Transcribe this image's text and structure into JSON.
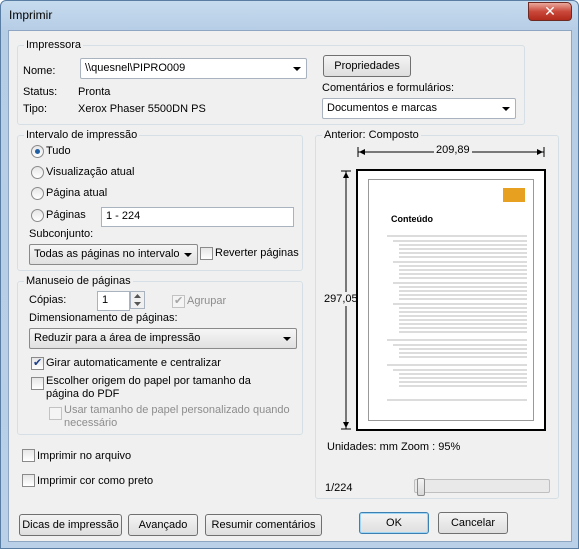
{
  "window": {
    "title": "Imprimir",
    "close_glyph": "✕"
  },
  "printer": {
    "group_label": "Impressora",
    "name_label": "Nome:",
    "name_value": "\\\\quesnel\\PIPRO009",
    "status_label": "Status:",
    "status_value": "Pronta",
    "type_label": "Tipo:",
    "type_value": "Xerox Phaser 5500DN PS",
    "properties_button": "Propriedades",
    "comments_label": "Comentários e formulários:",
    "comments_value": "Documentos e marcas"
  },
  "range": {
    "group_label": "Intervalo de impressão",
    "options": [
      "Tudo",
      "Visualização atual",
      "Página atual",
      "Páginas"
    ],
    "selected": "Tudo",
    "pages_value": "1 - 224",
    "subset_label": "Subconjunto:",
    "subset_value": "Todas as páginas no intervalo",
    "reverse_label": "Reverter páginas"
  },
  "handling": {
    "group_label": "Manuseio de páginas",
    "copies_label": "Cópias:",
    "copies_value": "1",
    "collate_label": "Agrupar",
    "sizing_label": "Dimensionamento de páginas:",
    "sizing_value": "Reduzir para a área de impressão",
    "auto_rotate_label": "Girar automaticamente e centralizar",
    "paper_source_label": "Escolher origem do papel por tamanho da página do PDF",
    "custom_paper_label": "Usar tamanho de papel personalizado quando necessário"
  },
  "options": {
    "print_to_file": "Imprimir no arquivo",
    "print_grayscale": "Imprimir cor como preto"
  },
  "preview": {
    "label": "Anterior: Composto",
    "width": "209,89",
    "height": "297,05",
    "units_zoom": "Unidades: mm Zoom :  95%",
    "page_counter": "1/224",
    "doc_title": "Conteúdo"
  },
  "buttons": {
    "tips": "Dicas de impressão",
    "advanced": "Avançado",
    "summarize": "Resumir comentários",
    "ok": "OK",
    "cancel": "Cancelar"
  },
  "colors": {
    "accent": "#1e5fa6",
    "logo": "#e8a020"
  }
}
